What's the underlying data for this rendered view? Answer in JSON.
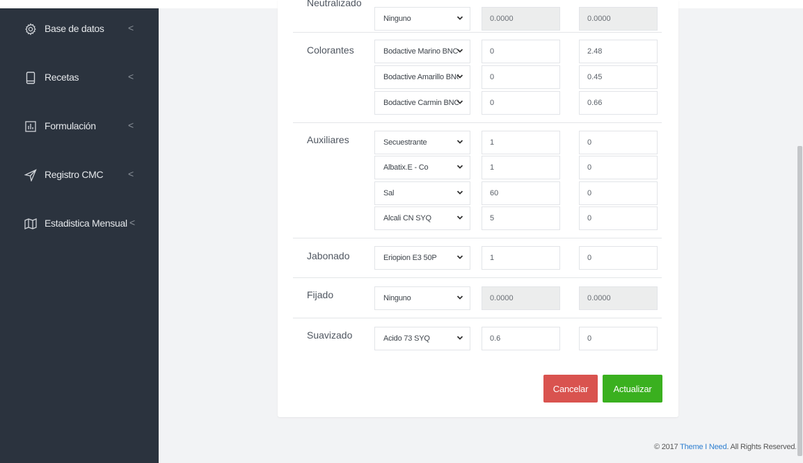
{
  "sidebar": {
    "items": [
      {
        "label": "Base de datos",
        "icon": "gear-icon"
      },
      {
        "label": "Recetas",
        "icon": "tablet-icon"
      },
      {
        "label": "Formulación",
        "icon": "bar-chart-icon"
      },
      {
        "label": "Registro CMC",
        "icon": "send-icon"
      },
      {
        "label": "Estadistica Mensual",
        "icon": "map-icon"
      }
    ],
    "arrow": "<"
  },
  "form": {
    "neutralizado": {
      "label": "Neutralizado",
      "select": "Ninguno",
      "value_a": "0.0000",
      "value_b": "0.0000"
    },
    "colorantes": {
      "label": "Colorantes",
      "rows": [
        {
          "select": "Bodactive Marino BNC-GI",
          "value_a": "0",
          "value_b": "2.48"
        },
        {
          "select": "Bodactive Amarillo BNC",
          "value_a": "0",
          "value_b": "0.45"
        },
        {
          "select": "Bodactive Carmin BNC",
          "value_a": "0",
          "value_b": "0.66"
        }
      ]
    },
    "auxiliares": {
      "label": "Auxiliares",
      "rows": [
        {
          "select": "Secuestrante",
          "value_a": "1",
          "value_b": "0"
        },
        {
          "select": "Albatix.E - Co",
          "value_a": "1",
          "value_b": "0"
        },
        {
          "select": "Sal",
          "value_a": "60",
          "value_b": "0"
        },
        {
          "select": "Alcali CN SYQ",
          "value_a": "5",
          "value_b": "0"
        }
      ]
    },
    "jabonado": {
      "label": "Jabonado",
      "select": "Eriopion E3 50P",
      "value_a": "1",
      "value_b": "0"
    },
    "fijado": {
      "label": "Fijado",
      "select": "Ninguno",
      "value_a": "0.0000",
      "value_b": "0.0000"
    },
    "suavizado": {
      "label": "Suavizado",
      "select": "Acido 73 SYQ",
      "value_a": "0.6",
      "value_b": "0"
    }
  },
  "buttons": {
    "cancel": "Cancelar",
    "update": "Actualizar"
  },
  "footer": {
    "prefix": "© 2017 ",
    "link": "Theme I Need",
    "suffix": ". All Rights Reserved."
  },
  "colors": {
    "sidebar_bg": "#2b333e",
    "cancel": "#d9534f",
    "update": "#3ab01f",
    "link": "#2f7fd0"
  }
}
